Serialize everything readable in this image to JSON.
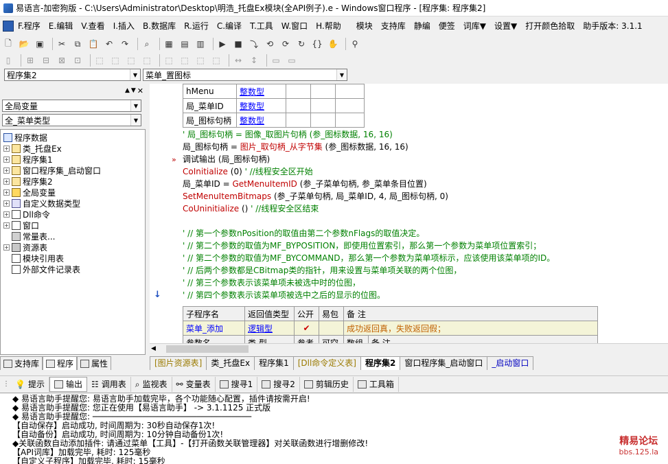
{
  "window": {
    "title": "易语言-加密狗版 - C:\\Users\\Administrator\\Desktop\\明浩_托盘Ex模块(全API例子).e - Windows窗口程序 - [程序集: 程序集2]"
  },
  "menu": {
    "items": [
      "F.程序",
      "E.编辑",
      "V.查看",
      "I.插入",
      "B.数据库",
      "R.运行",
      "C.编译",
      "T.工具",
      "W.窗口",
      "H.帮助",
      "模块",
      "支持库",
      "静编",
      "便签",
      "词库▼",
      "设置▼",
      "打开颜色拾取",
      "助手版本: 3.1.1"
    ]
  },
  "selectors": {
    "assembly": "程序集2",
    "subroutine": "菜单_置图标",
    "scope": "全局变量",
    "datatype": "全_菜单类型"
  },
  "tree": {
    "root": "程序数据",
    "items": [
      "类_托盘Ex",
      "程序集1",
      "窗口程序集_启动窗口",
      "程序集2",
      "全局变量",
      "自定义数据类型",
      "Dll命令",
      "窗口",
      "常量表...",
      "资源表",
      "模块引用表",
      "外部文件记录表"
    ]
  },
  "left_tabs": [
    "支持库",
    "程序",
    "属性"
  ],
  "var_table": [
    [
      "hMenu",
      "整数型"
    ],
    [
      "局_菜单ID",
      "整数型"
    ],
    [
      "局_图标句柄",
      "整数型"
    ]
  ],
  "code_lines": [
    {
      "parts": [
        {
          "c": "cm",
          "t": "' 局_图标句柄 = 图像_取图片句柄 (参_图标数据, 16, 16)"
        }
      ]
    },
    {
      "parts": [
        {
          "c": "nm",
          "t": "局_图标句柄 = "
        },
        {
          "c": "kw",
          "t": "图片_取句柄_从字节集"
        },
        {
          "c": "nm",
          "t": " (参_图标数据, 16, 16)"
        }
      ]
    },
    {
      "parts": [
        {
          "c": "nm",
          "t": "调试输出 (局_图标句柄)"
        }
      ]
    },
    {
      "parts": [
        {
          "c": "kw",
          "t": "CoInitialize"
        },
        {
          "c": "nm",
          "t": " (0) "
        },
        {
          "c": "cm",
          "t": " ' //线程安全区开始"
        }
      ]
    },
    {
      "parts": [
        {
          "c": "nm",
          "t": "局_菜单ID = "
        },
        {
          "c": "kw",
          "t": "GetMenuItemID"
        },
        {
          "c": "nm",
          "t": " (参_子菜单句柄, 参_菜单条目位置)"
        }
      ]
    },
    {
      "parts": [
        {
          "c": "kw",
          "t": "SetMenuItemBitmaps"
        },
        {
          "c": "nm",
          "t": " (参_子菜单句柄, 局_菜单ID, 4, 局_图标句柄, 0)"
        }
      ]
    },
    {
      "parts": [
        {
          "c": "kw",
          "t": "CoUninitialize"
        },
        {
          "c": "nm",
          "t": " () "
        },
        {
          "c": "cm",
          "t": " ' //线程安全区结束"
        }
      ]
    },
    {
      "parts": []
    },
    {
      "parts": [
        {
          "c": "cm",
          "t": "' // 第一个参数nPosition的取值由第二个参数nFlags的取值决定。"
        }
      ]
    },
    {
      "parts": [
        {
          "c": "cm",
          "t": "' // 第二个参数的取值为MF_BYPOSITION，即使用位置索引，那么第一个参数为菜单项位置索引；"
        }
      ]
    },
    {
      "parts": [
        {
          "c": "cm",
          "t": "' // 第二个参数的取值为MF_BYCOMMAND，那么第一个参数为菜单项标示，应该使用该菜单项的ID。"
        }
      ]
    },
    {
      "parts": [
        {
          "c": "cm",
          "t": "' // 后两个参数都是CBitmap类的指针，用来设置与菜单项关联的两个位图，"
        }
      ]
    },
    {
      "parts": [
        {
          "c": "cm",
          "t": "' // 第三个参数表示该菜单项未被选中时的位图，"
        }
      ]
    },
    {
      "parts": [
        {
          "c": "cm",
          "t": "' // 第四个参数表示该菜单项被选中之后的显示的位图。"
        }
      ]
    }
  ],
  "sub_table": {
    "headers": [
      "子程序名",
      "返回值类型",
      "公开",
      "易包",
      "备 注"
    ],
    "row": [
      "菜单_添加",
      "逻辑型",
      "✔",
      "",
      "成功返回真，失败返回假；"
    ],
    "headers2": [
      "参数名",
      "类 型",
      "参考",
      "可空",
      "数组",
      "备 注"
    ]
  },
  "editor_tabs": [
    "[图片资源表]",
    "类_托盘Ex",
    "程序集1",
    "[Dll命令定义表]",
    "程序集2",
    "窗口程序集_启动窗口",
    "_启动窗口"
  ],
  "bottom_tabs": [
    "提示",
    "输出",
    "调用表",
    "监视表",
    "变量表",
    "搜寻1",
    "搜寻2",
    "剪辑历史",
    "工具箱"
  ],
  "output_lines": [
    "◆ 易语言助手提醒您: 易语言助手加载完毕，各个功能随心配置，插件请按需开启!",
    "◆ 易语言助手提醒您: 您正在使用【易语言助手】 -> 3.1.1125 正式版",
    "◆ 易语言助手提醒您: ────────────────────────────────",
    "【自动保存】启动成功, 时间周期为: 30秒自动保存1次!",
    "【自动备份】启动成功, 时间周期为: 10分钟自动备份1次!",
    "◆关联函数自动添加插件: 请通过菜单【工具】-【打开函数关联管理器】对关联函数进行增删修改!",
    "【API词库】加载完毕, 耗时: 125毫秒",
    "【自定义子程序】加载完毕, 耗时: 15毫秒"
  ],
  "watermark": {
    "line1": "精易论坛",
    "line2": "bbs.125.la"
  }
}
